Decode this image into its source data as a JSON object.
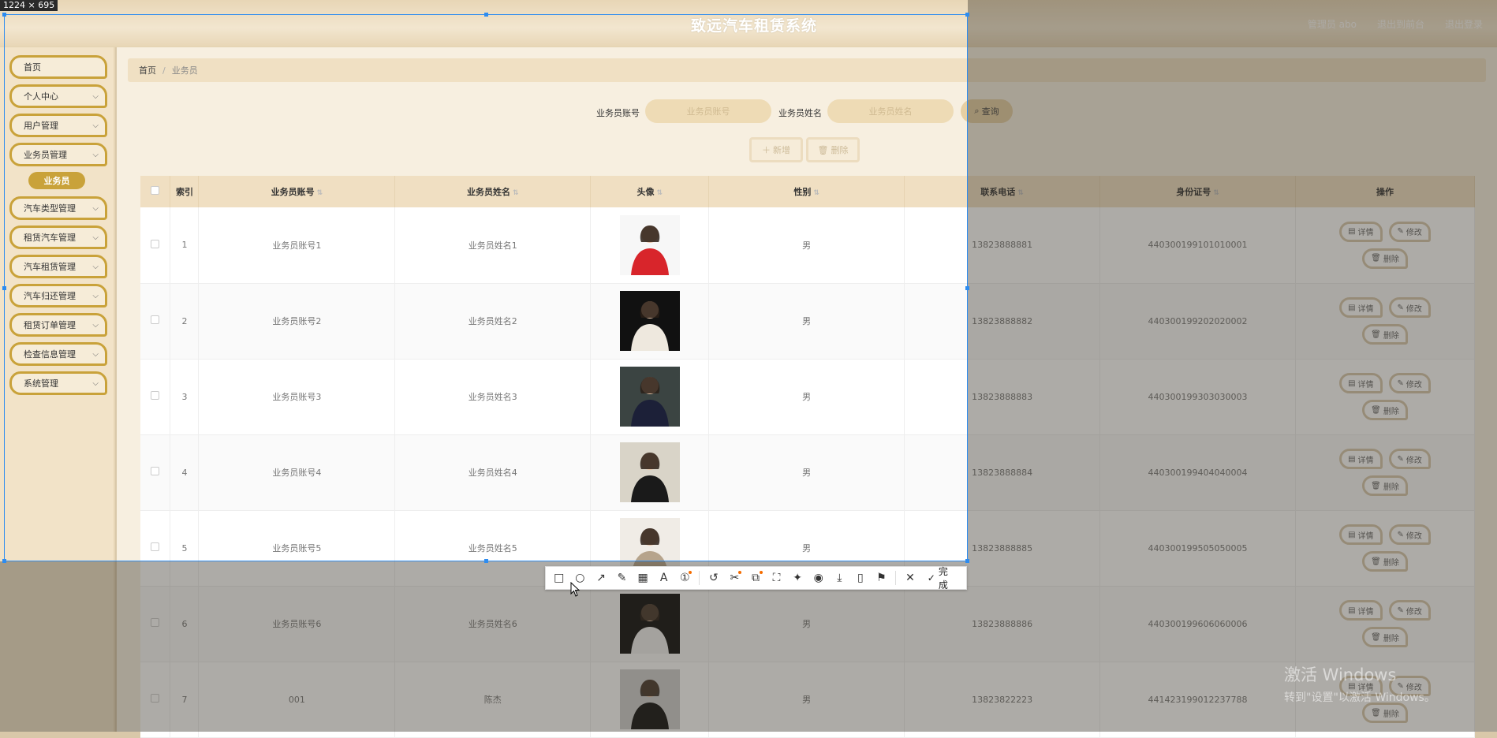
{
  "capture": {
    "size_label": "1224 × 695"
  },
  "header": {
    "title": "致远汽车租赁系统",
    "links": [
      "管理员 abo",
      "退出到前台",
      "退出登录"
    ]
  },
  "sidebar": {
    "items": [
      {
        "label": "首页",
        "chevron": false
      },
      {
        "label": "个人中心",
        "chevron": true
      },
      {
        "label": "用户管理",
        "chevron": true
      },
      {
        "label": "业务员管理",
        "chevron": true
      },
      {
        "label": "汽车类型管理",
        "chevron": true
      },
      {
        "label": "租赁汽车管理",
        "chevron": true
      },
      {
        "label": "汽车租赁管理",
        "chevron": true
      },
      {
        "label": "汽车归还管理",
        "chevron": true
      },
      {
        "label": "租赁订单管理",
        "chevron": true
      },
      {
        "label": "检查信息管理",
        "chevron": true
      },
      {
        "label": "系统管理",
        "chevron": true
      }
    ],
    "active_sub": "业务员"
  },
  "breadcrumb": {
    "home": "首页",
    "current": "业务员"
  },
  "search": {
    "account_label": "业务员账号",
    "account_placeholder": "业务员账号",
    "name_label": "业务员姓名",
    "name_placeholder": "业务员姓名",
    "query_label": "查询"
  },
  "actions": {
    "add_label": "新增",
    "delete_label": "删除"
  },
  "table": {
    "headers": [
      "索引",
      "业务员账号",
      "业务员姓名",
      "头像",
      "性别",
      "联系电话",
      "身份证号",
      "操作"
    ],
    "row_actions": {
      "detail": "详情",
      "edit": "修改",
      "delete": "删除"
    },
    "rows": [
      {
        "index": "1",
        "account": "业务员账号1",
        "name": "业务员姓名1",
        "gender": "男",
        "phone": "13823888881",
        "id_card": "440300199101010001"
      },
      {
        "index": "2",
        "account": "业务员账号2",
        "name": "业务员姓名2",
        "gender": "男",
        "phone": "13823888882",
        "id_card": "440300199202020002"
      },
      {
        "index": "3",
        "account": "业务员账号3",
        "name": "业务员姓名3",
        "gender": "男",
        "phone": "13823888883",
        "id_card": "440300199303030003"
      },
      {
        "index": "4",
        "account": "业务员账号4",
        "name": "业务员姓名4",
        "gender": "男",
        "phone": "13823888884",
        "id_card": "440300199404040004"
      },
      {
        "index": "5",
        "account": "业务员账号5",
        "name": "业务员姓名5",
        "gender": "男",
        "phone": "13823888885",
        "id_card": "440300199505050005"
      },
      {
        "index": "6",
        "account": "业务员账号6",
        "name": "业务员姓名6",
        "gender": "男",
        "phone": "13823888886",
        "id_card": "440300199606060006"
      },
      {
        "index": "7",
        "account": "001",
        "name": "陈杰",
        "gender": "男",
        "phone": "13823822223",
        "id_card": "441423199012237788"
      }
    ]
  },
  "snip_toolbar": {
    "tools": [
      "rectangle-icon",
      "circle-icon",
      "arrow-icon",
      "pen-icon",
      "mosaic-icon",
      "text-icon",
      "number-icon",
      "undo-icon",
      "cutout-icon",
      "ocr-icon",
      "scroll-capture-icon",
      "pin-icon",
      "record-icon",
      "download-icon",
      "phone-icon",
      "bookmark-icon"
    ],
    "done_label": "完成"
  },
  "watermark": {
    "line1": "激活 Windows",
    "line2": "转到\"设置\"以激活 Windows。"
  }
}
